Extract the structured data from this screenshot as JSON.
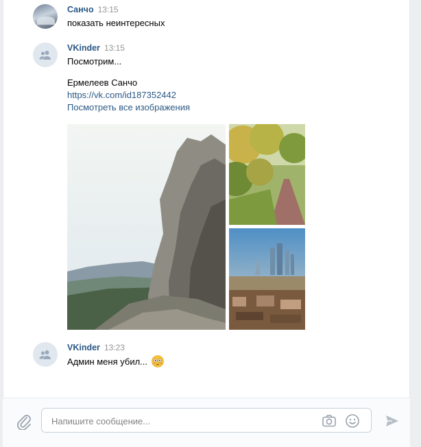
{
  "messages": [
    {
      "author": "Санчо",
      "time": "13:15",
      "text": "показать неинтересных"
    },
    {
      "author": "VKinder",
      "time": "13:15",
      "text": "Посмотрим...",
      "name": "Ермелеев Санчо",
      "url": "https://vk.com/id187352442",
      "all_images": "Посмотреть все изображения",
      "images": [
        "rock-cliff-photo",
        "autumn-path-photo",
        "city-skyline-photo"
      ]
    },
    {
      "author": "VKinder",
      "time": "13:23",
      "text": "Админ меня убил...",
      "emoji": "flushed-face-icon"
    }
  ],
  "composer": {
    "placeholder": "Напишите сообщение...",
    "icons": [
      "paperclip-icon",
      "camera-icon",
      "smile-icon",
      "send-icon"
    ]
  },
  "colors": {
    "author": "#2a5885",
    "link": "#2a5885",
    "time": "#939393",
    "background": "#edeef0"
  }
}
